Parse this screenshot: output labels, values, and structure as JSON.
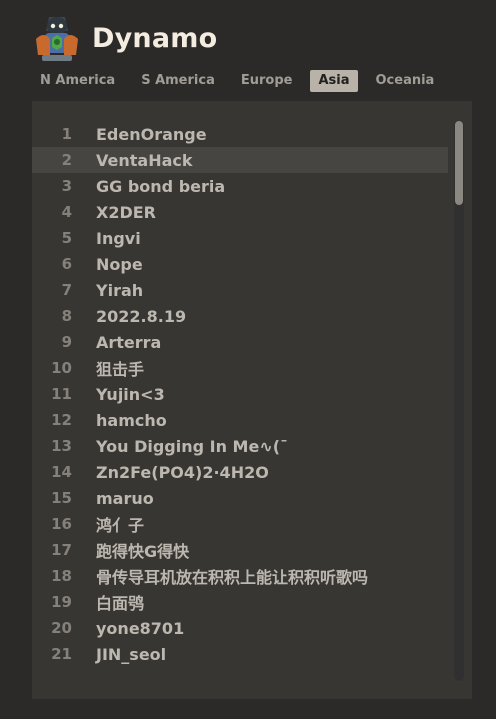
{
  "hero": {
    "name": "Dynamo",
    "icon": "dynamo-hero-portrait"
  },
  "regions": [
    {
      "label": "N America",
      "active": false
    },
    {
      "label": "S America",
      "active": false
    },
    {
      "label": "Europe",
      "active": false
    },
    {
      "label": "Asia",
      "active": true
    },
    {
      "label": "Oceania",
      "active": false
    }
  ],
  "leaderboard": [
    {
      "rank": "1",
      "name": "EdenOrange"
    },
    {
      "rank": "2",
      "name": "VentaHack"
    },
    {
      "rank": "3",
      "name": "GG bond beria"
    },
    {
      "rank": "4",
      "name": "X2DER"
    },
    {
      "rank": "5",
      "name": "Ingvi"
    },
    {
      "rank": "6",
      "name": "Nope"
    },
    {
      "rank": "7",
      "name": "Yirah"
    },
    {
      "rank": "8",
      "name": "2022.8.19"
    },
    {
      "rank": "9",
      "name": "Arterra"
    },
    {
      "rank": "10",
      "name": "狙击手"
    },
    {
      "rank": "11",
      "name": "Yujin<3"
    },
    {
      "rank": "12",
      "name": "hamcho"
    },
    {
      "rank": "13",
      "name": "You Digging In Me∿(¯"
    },
    {
      "rank": "14",
      "name": "Zn2Fe(PO4)2·4H2O"
    },
    {
      "rank": "15",
      "name": "maruo"
    },
    {
      "rank": "16",
      "name": "鸿亻子"
    },
    {
      "rank": "17",
      "name": "跑得快G得快"
    },
    {
      "rank": "18",
      "name": "骨传导耳机放在积积上能让积积听歌吗"
    },
    {
      "rank": "19",
      "name": "白面鸮"
    },
    {
      "rank": "20",
      "name": "yone8701"
    },
    {
      "rank": "21",
      "name": "JIN_seol"
    }
  ],
  "highlighted_rank": "2",
  "colors": {
    "background": "#2b2a28",
    "panel": "#383633",
    "active_tab": "#b8b2a9",
    "title": "#f4ece0"
  }
}
